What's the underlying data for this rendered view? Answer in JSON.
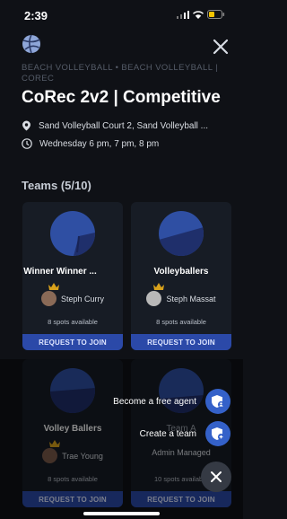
{
  "status_bar": {
    "time": "2:39"
  },
  "breadcrumb": {
    "text": "BEACH VOLLEYBALL • BEACH VOLLEYBALL | COREC"
  },
  "title": "CoRec 2v2 | Competitive",
  "location": "Sand Volleyball Court 2, Sand Volleyball ...",
  "schedule": "Wednesday 6 pm, 7 pm, 8 pm",
  "teams_header": "Teams (5/10)",
  "teams": [
    {
      "name": "Winner Winner ...",
      "captain": "Steph Curry",
      "spots": "8 spots available",
      "button": "REQUEST TO JOIN"
    },
    {
      "name": "Volleyballers",
      "captain": "Steph Massat",
      "spots": "8 spots available",
      "button": "REQUEST TO JOIN"
    },
    {
      "name": "Volley Ballers",
      "captain": "Trae Young",
      "spots": "8 spots available",
      "button": "REQUEST TO JOIN"
    },
    {
      "name": "Team A",
      "captain": "Admin Managed",
      "spots": "10 spots available",
      "button": "REQUEST TO JOIN"
    }
  ],
  "fab_menu": {
    "free_agent_label": "Become a free agent",
    "create_team_label": "Create a team"
  },
  "colors": {
    "accent": "#2b49a8",
    "background": "#0f1116",
    "card": "#171c25",
    "crown": "#d9a21b"
  }
}
